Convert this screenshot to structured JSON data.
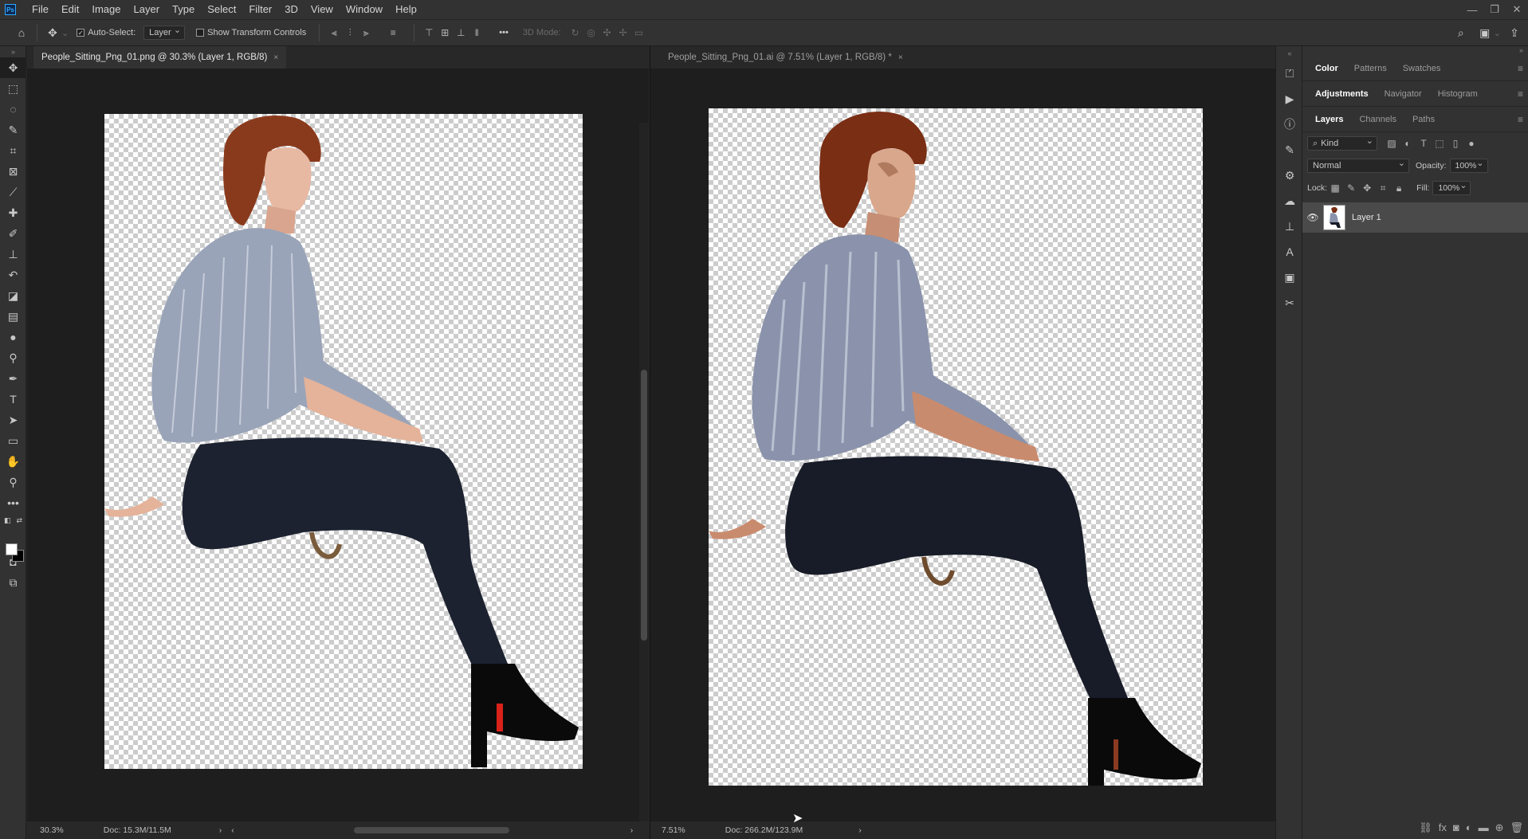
{
  "app": {
    "logo": "Ps"
  },
  "menu": [
    "File",
    "Edit",
    "Image",
    "Layer",
    "Type",
    "Select",
    "Filter",
    "3D",
    "View",
    "Window",
    "Help"
  ],
  "window_controls": {
    "minimize": "—",
    "restore": "❐",
    "close": "✕"
  },
  "options": {
    "auto_select_label": "Auto-Select:",
    "auto_select_checked": "✓",
    "auto_select_target": "Layer",
    "show_transform_label": "Show Transform Controls",
    "more": "•••",
    "mode_3d_label": "3D Mode:"
  },
  "documents": [
    {
      "title": "People_Sitting_Png_01.png @ 30.3% (Layer 1, RGB/8)",
      "close": "×",
      "zoom": "30.3%",
      "doc_info": "Doc: 15.3M/11.5M"
    },
    {
      "title": "People_Sitting_Png_01.ai @ 7.51% (Layer 1, RGB/8) *",
      "close": "×",
      "zoom": "7.51%",
      "doc_info": "Doc: 266.2M/123.9M"
    }
  ],
  "panels": {
    "color_group": {
      "tabs": [
        "Color",
        "Patterns",
        "Swatches"
      ],
      "active": "Color"
    },
    "adjust_group": {
      "tabs": [
        "Adjustments",
        "Navigator",
        "Histogram"
      ],
      "active": "Adjustments"
    },
    "layers_group": {
      "tabs": [
        "Layers",
        "Channels",
        "Paths"
      ],
      "active": "Layers"
    },
    "layers": {
      "filter_kind": "Kind",
      "blend_mode": "Normal",
      "opacity_label": "Opacity:",
      "opacity_value": "100%",
      "lock_label": "Lock:",
      "fill_label": "Fill:",
      "fill_value": "100%",
      "items": [
        {
          "name": "Layer 1",
          "visible": true
        }
      ]
    }
  },
  "colors": {
    "accent": "#31a8ff",
    "panel_bg": "#323232",
    "canvas_bg": "#1e1e1e",
    "fg_swatch": "#ffffff",
    "bg_swatch": "#000000"
  }
}
